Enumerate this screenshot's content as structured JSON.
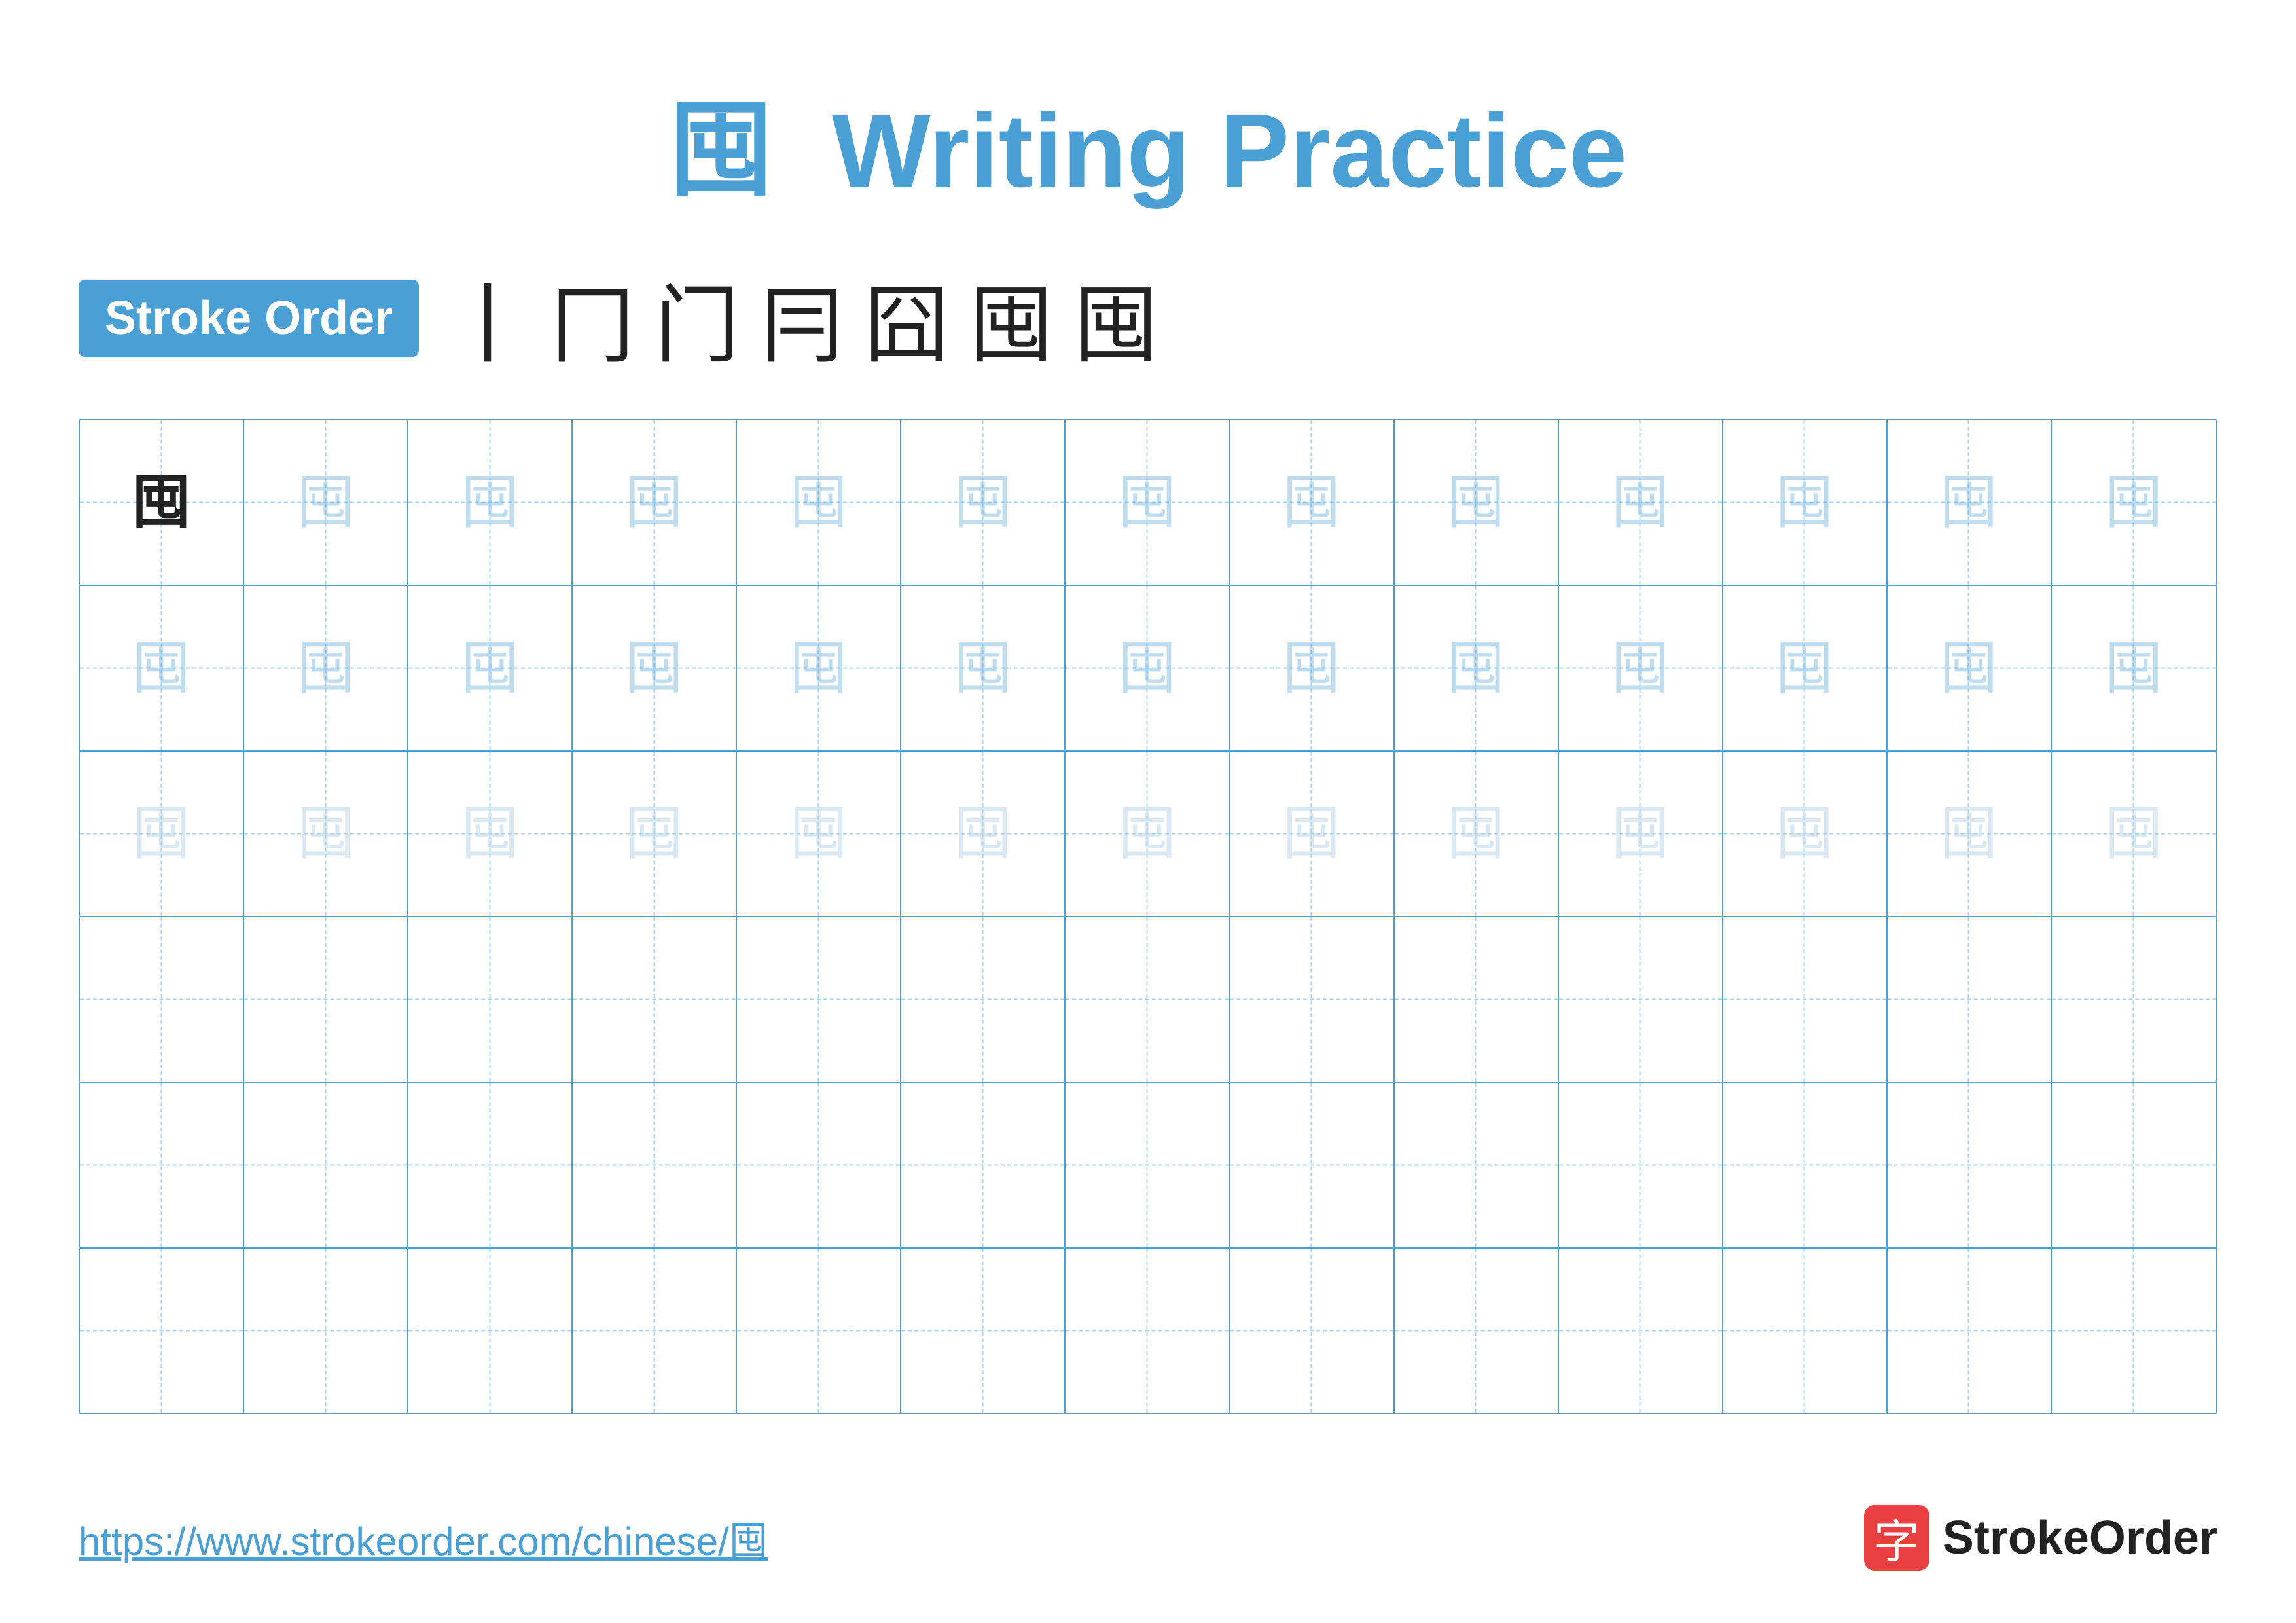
{
  "title": {
    "char": "囤",
    "label": "Writing Practice",
    "color": "#4a9fd4"
  },
  "stroke_order": {
    "badge_label": "Stroke Order",
    "strokes": [
      "丨",
      "冂",
      "门",
      "冃",
      "囧",
      "囤",
      "囤"
    ]
  },
  "grid": {
    "rows": 6,
    "cols": 13,
    "char": "囤",
    "row_styles": [
      "dark_first",
      "light_blue",
      "lighter",
      "empty",
      "empty",
      "empty"
    ]
  },
  "footer": {
    "url": "https://www.strokeorder.com/chinese/囤",
    "brand_name": "StrokeOrder",
    "brand_icon": "字"
  }
}
